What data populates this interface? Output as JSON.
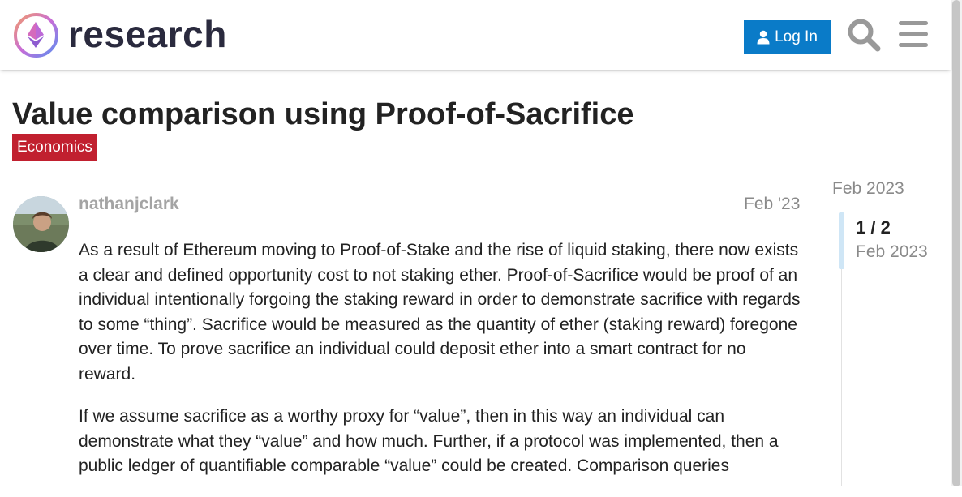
{
  "header": {
    "logo_text": "research",
    "login_label": "Log In",
    "search_icon": "search-icon",
    "menu_icon": "hamburger-menu-icon",
    "login_color": "#0a7bc8"
  },
  "topic": {
    "title": "Value comparison using Proof-of-Sacrifice",
    "category": "Economics",
    "category_color": "#c1202f"
  },
  "post": {
    "username": "nathanjclark",
    "date": "Feb '23",
    "paragraphs": [
      "As a result of Ethereum moving to Proof-of-Stake and the rise of liquid staking, there now exists a clear and defined opportunity cost to not staking ether. Proof-of-Sacrifice would be proof of an individual intentionally forgoing the staking reward in order to demonstrate sacrifice with regards to some “thing”. Sacrifice would be measured as the quantity of ether (staking reward) foregone over time. To prove sacrifice an individual could deposit ether into a smart contract for no reward.",
      "If we assume sacrifice as a worthy proxy for “value”, then in this way an individual can demonstrate what they “value” and how much. Further, if a protocol was implemented, then a public ledger of quantifiable comparable “value” could be created. Comparison queries"
    ]
  },
  "timeline": {
    "start_date": "Feb 2023",
    "count": "1 / 2",
    "current_date": "Feb 2023"
  }
}
